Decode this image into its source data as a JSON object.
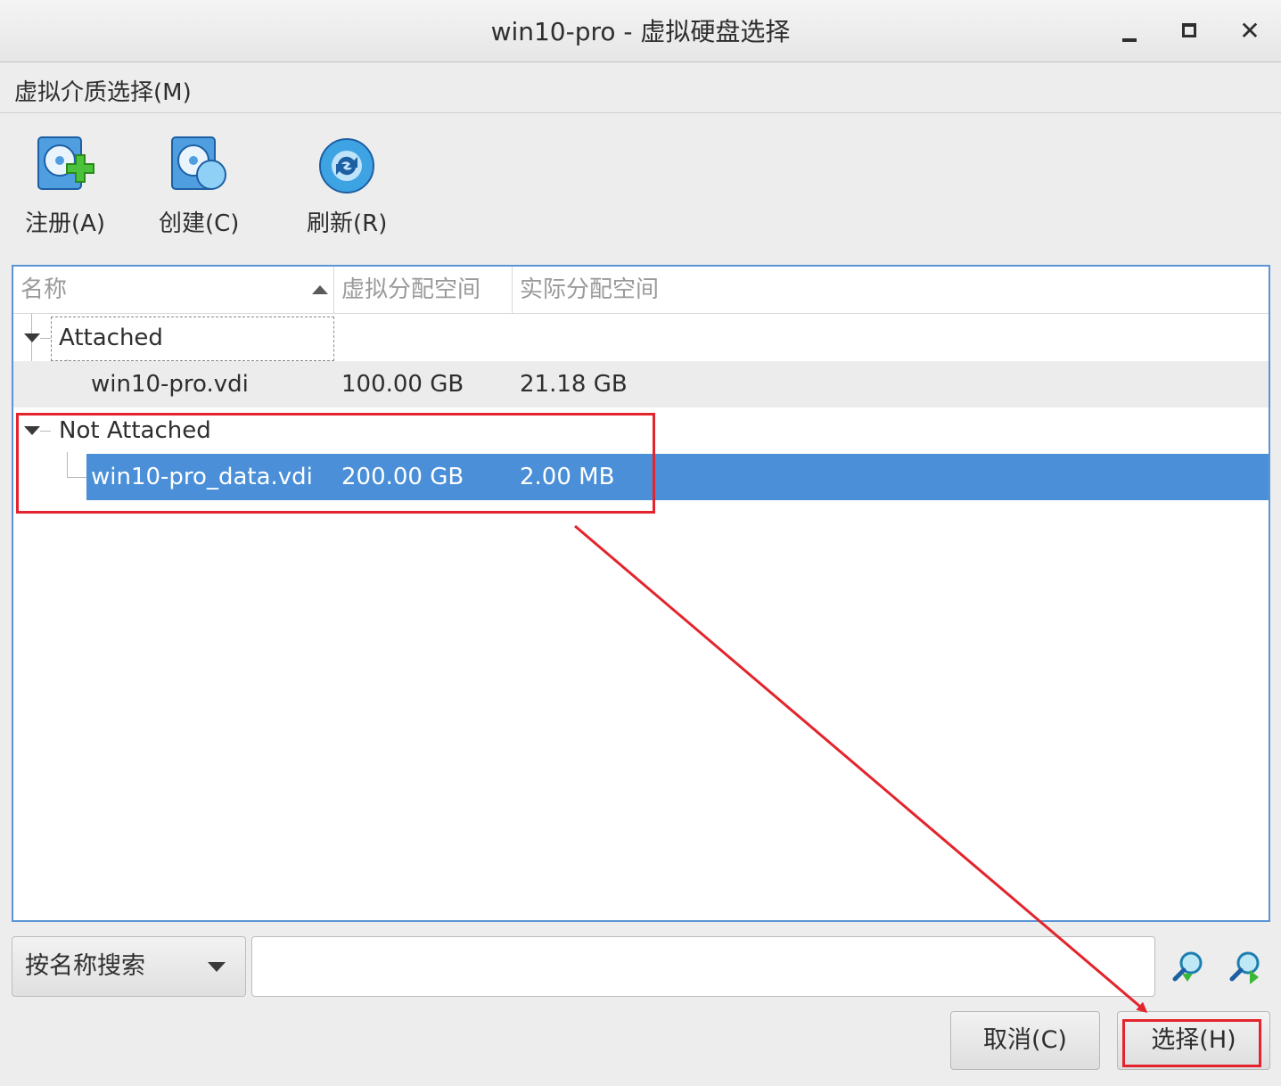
{
  "window": {
    "title": "win10-pro - 虚拟硬盘选择"
  },
  "menu": {
    "items": [
      {
        "label": "虚拟介质选择(M)"
      }
    ]
  },
  "toolbar": {
    "add_label": "注册(A)",
    "create_label": "创建(C)",
    "refresh_label": "刷新(R)"
  },
  "table": {
    "columns": [
      "名称",
      "虚拟分配空间",
      "实际分配空间"
    ],
    "groups": [
      {
        "label": "Attached",
        "items": [
          {
            "name": "win10-pro.vdi",
            "virtual": "100.00 GB",
            "actual": "21.18 GB"
          }
        ]
      },
      {
        "label": "Not Attached",
        "items": [
          {
            "name": "win10-pro_data.vdi",
            "virtual": "200.00 GB",
            "actual": "2.00 MB",
            "selected": true
          }
        ]
      }
    ]
  },
  "search": {
    "mode": "按名称搜索",
    "value": ""
  },
  "buttons": {
    "cancel": "取消(C)",
    "select": "选择(H)"
  },
  "colors": {
    "selection": "#4a8fd7",
    "annotation": "#e4242d",
    "table_border": "#5b95d6"
  }
}
